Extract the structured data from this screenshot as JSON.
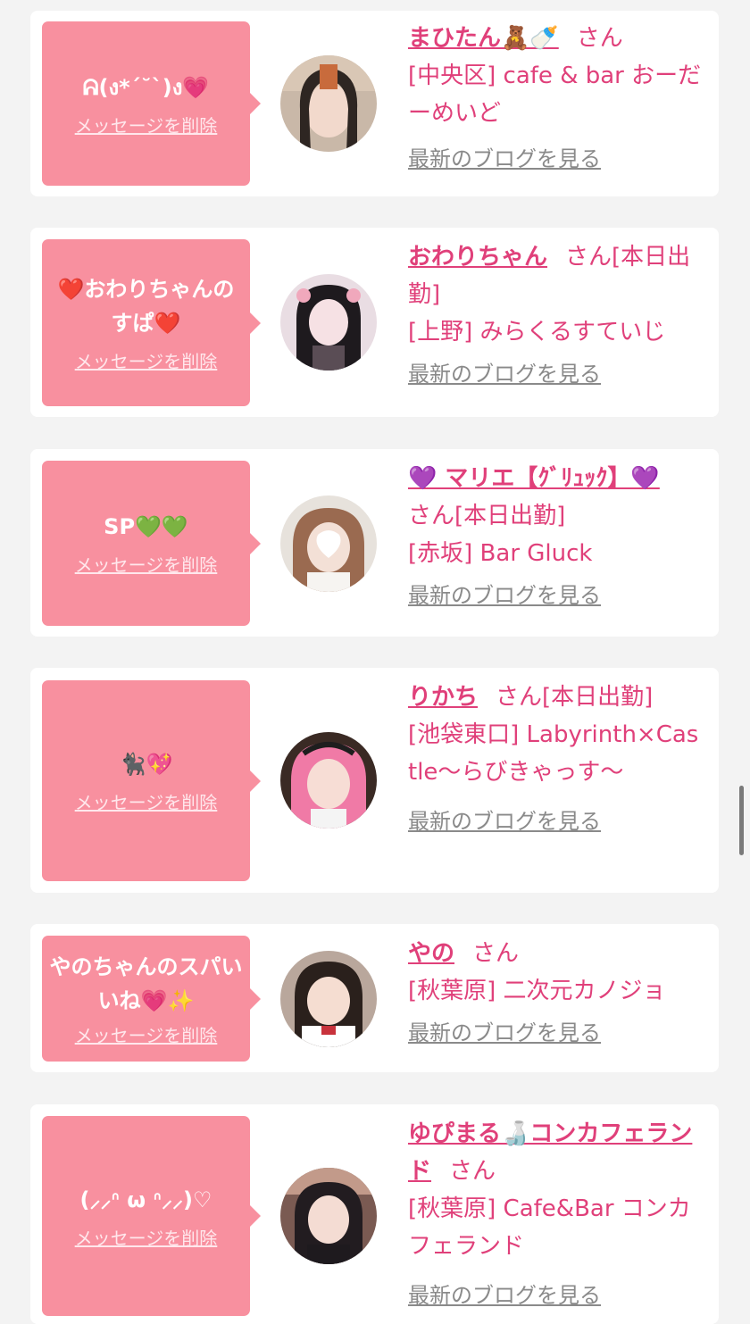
{
  "delete_label": "メッセージを削除",
  "blog_label": "最新のブログを見る",
  "colors": {
    "bubble": "#f8909f",
    "accent": "#e0407a",
    "link_gray": "#8a8a8a",
    "page_bg": "#f3f3f3"
  },
  "cards": [
    {
      "message": "ᕱ(ง*´˘`)ง💗",
      "name": "まひたん🧸🍼",
      "suffix": "さん",
      "shop": "[中央区] cafe & bar おーだーめいど"
    },
    {
      "message": "❤️おわりちゃんのすぱ❤️",
      "name": "おわりちゃん",
      "suffix": "さん[本日出勤]",
      "shop": "[上野] みらくるすていじ"
    },
    {
      "message": "SP💚💚",
      "name": "💜 マリエ【ｸﾞﾘｭｯｸ】💜",
      "suffix": "さん[本日出勤]",
      "shop": "[赤坂] Bar Gluck"
    },
    {
      "message": "🐈‍⬛💖",
      "name": "りかち",
      "suffix": "さん[本日出勤]",
      "shop": "[池袋東口] Labyrinth×Castle〜らびきゃっす〜"
    },
    {
      "message": "やのちゃんのスパいいね💗✨",
      "name": "やの",
      "suffix": "さん",
      "shop": "[秋葉原] 二次元カノジョ"
    },
    {
      "message": "(⸝⸝ᐢ ω ᐢ⸝⸝)♡",
      "name": "ゆぴまる🍶コンカフェランド",
      "suffix": "さん",
      "shop": "[秋葉原] Cafe&Bar コンカフェランド"
    }
  ]
}
